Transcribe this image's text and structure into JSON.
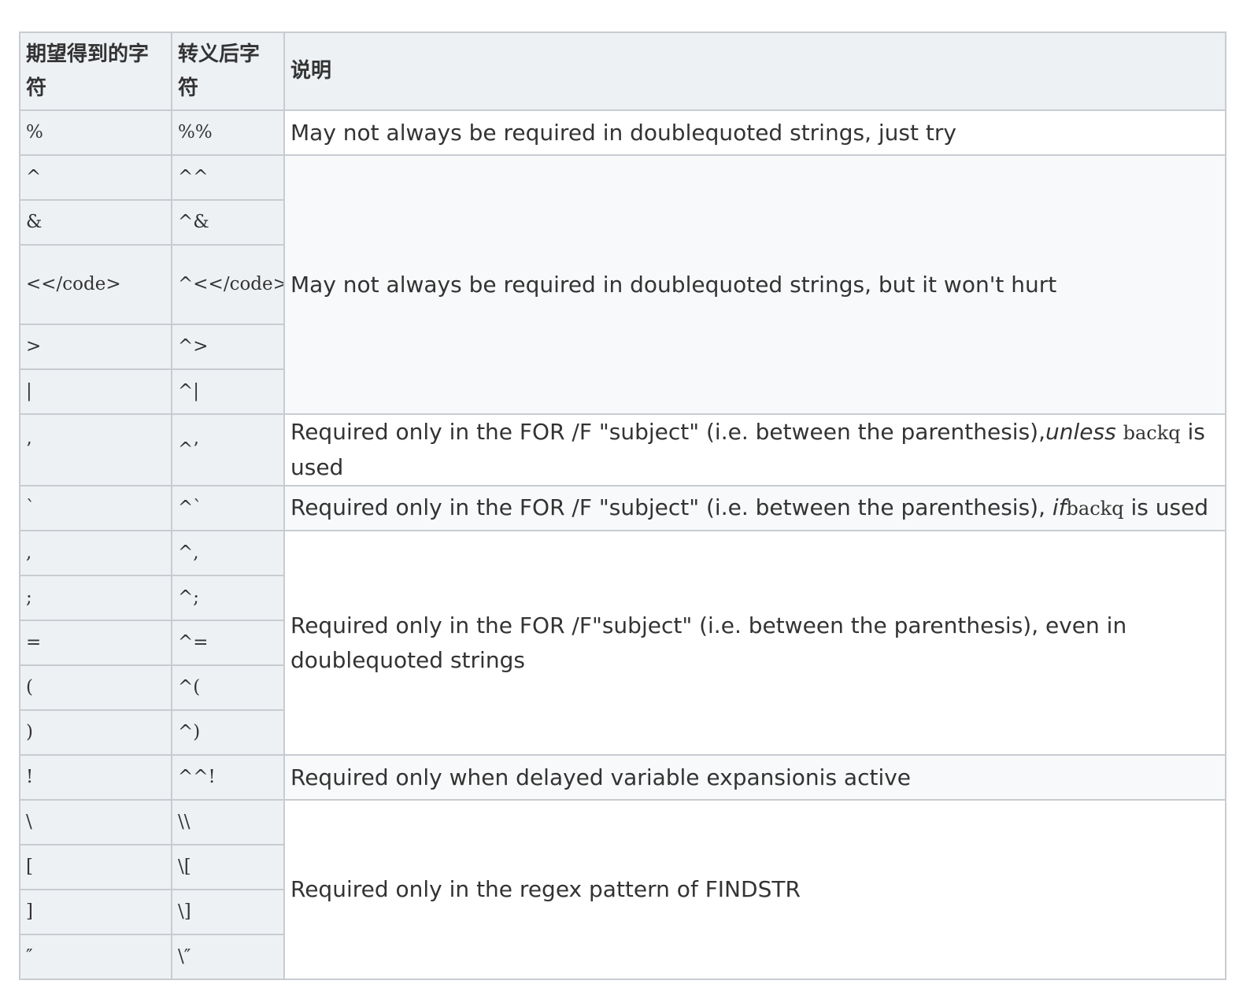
{
  "table": {
    "headers": [
      "期望得到的字符",
      "转义后字符",
      "说明"
    ],
    "rows": [
      {
        "char": "%",
        "escaped": "%%"
      },
      {
        "char": "^",
        "escaped": "^^"
      },
      {
        "char": "&",
        "escaped": "^&"
      },
      {
        "char": "<</code>",
        "escaped": "^<</code>"
      },
      {
        "char": ">",
        "escaped": "^>"
      },
      {
        "char": "|",
        "escaped": "^|"
      },
      {
        "char": "’",
        "escaped": "^’"
      },
      {
        "char": "`",
        "escaped": "^`"
      },
      {
        "char": ",",
        "escaped": "^,"
      },
      {
        "char": ";",
        "escaped": "^;"
      },
      {
        "char": "=",
        "escaped": "^="
      },
      {
        "char": "(",
        "escaped": "^("
      },
      {
        "char": ")",
        "escaped": "^)"
      },
      {
        "char": "!",
        "escaped": "^^!"
      },
      {
        "char": "\\",
        "escaped": "\\\\"
      },
      {
        "char": "[",
        "escaped": "\\["
      },
      {
        "char": "]",
        "escaped": "\\]"
      },
      {
        "char": "″",
        "escaped": "\\″"
      }
    ],
    "descriptions": {
      "percent": "May not always be required in doublequoted strings, just try",
      "special": "May not always be required in doublequoted strings, but it won't hurt",
      "quote_pre": "Required only in the FOR /F \"subject\" (i.e. between the parenthesis),",
      "quote_em": "unless",
      "quote_code": "backq",
      "quote_post": " is used",
      "backtick_pre": "Required only in the FOR /F \"subject\" (i.e. between the parenthesis), ",
      "backtick_em": "if",
      "backtick_code": "backq",
      "backtick_post": " is used",
      "delims": "Required only in the FOR /F\"subject\" (i.e. between the parenthesis), even in doublequoted strings",
      "bang": "Required only when delayed variable expansionis active",
      "findstr": "Required only in the regex pattern of FINDSTR"
    }
  }
}
